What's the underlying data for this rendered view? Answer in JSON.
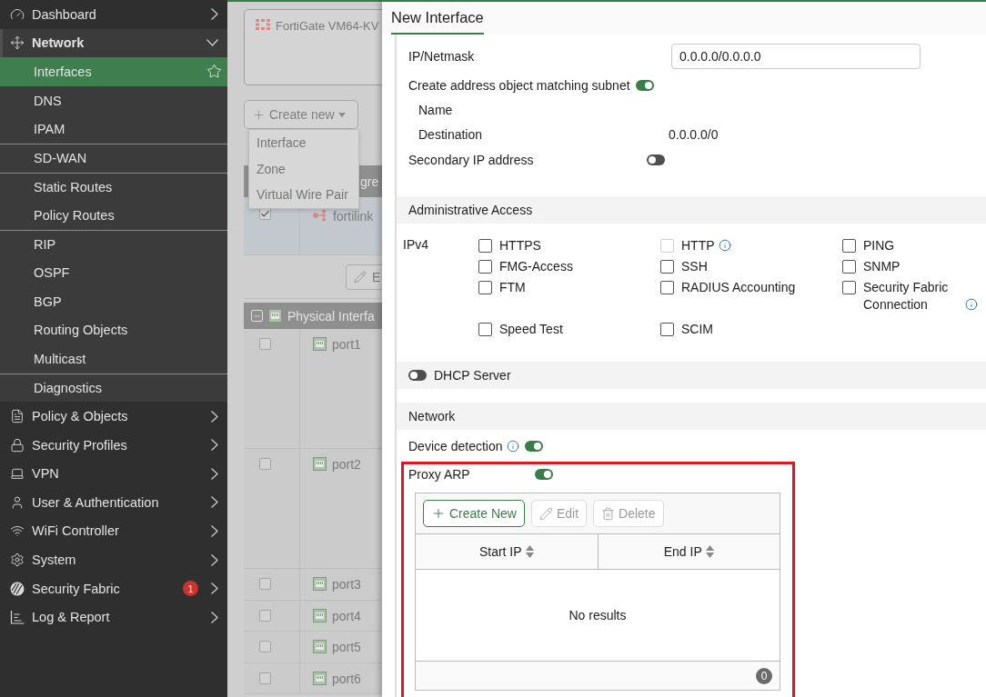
{
  "sidebar": {
    "items": [
      {
        "label": "Dashboard",
        "expanded": false
      },
      {
        "label": "Network",
        "expanded": true,
        "children": [
          {
            "label": "Interfaces",
            "selected": true,
            "divider_before": false
          },
          {
            "label": "DNS",
            "selected": false,
            "divider_before": false
          },
          {
            "label": "IPAM",
            "selected": false,
            "divider_before": false
          },
          {
            "label": "SD-WAN",
            "selected": false,
            "divider_before": true
          },
          {
            "label": "Static Routes",
            "selected": false,
            "divider_before": true
          },
          {
            "label": "Policy Routes",
            "selected": false,
            "divider_before": false
          },
          {
            "label": "RIP",
            "selected": false,
            "divider_before": true
          },
          {
            "label": "OSPF",
            "selected": false,
            "divider_before": false
          },
          {
            "label": "BGP",
            "selected": false,
            "divider_before": false
          },
          {
            "label": "Routing Objects",
            "selected": false,
            "divider_before": false
          },
          {
            "label": "Multicast",
            "selected": false,
            "divider_before": false
          },
          {
            "label": "Diagnostics",
            "selected": false,
            "divider_before": true
          }
        ]
      },
      {
        "label": "Policy & Objects",
        "expanded": false
      },
      {
        "label": "Security Profiles",
        "expanded": false
      },
      {
        "label": "VPN",
        "expanded": false
      },
      {
        "label": "User & Authentication",
        "expanded": false
      },
      {
        "label": "WiFi Controller",
        "expanded": false
      },
      {
        "label": "System",
        "expanded": false
      },
      {
        "label": "Security Fabric",
        "expanded": false,
        "badge": "1"
      },
      {
        "label": "Log & Report",
        "expanded": false
      }
    ]
  },
  "background_page": {
    "device_card": {
      "name": "FortiGate VM64-KV"
    },
    "create_button": "Create new",
    "create_menu": [
      "Interface",
      "Zone",
      "Virtual Wire Pair"
    ],
    "aggregate_header": "gre",
    "fortilink_row": {
      "name": "fortilink",
      "checked": true
    },
    "edit_button": "E",
    "physical_header": "Physical Interfa",
    "ports": [
      {
        "name": "port1",
        "checked": false
      },
      {
        "name": "port2",
        "checked": false
      },
      {
        "name": "port3",
        "checked": false
      },
      {
        "name": "port4",
        "checked": false
      },
      {
        "name": "port5",
        "checked": false
      },
      {
        "name": "port6",
        "checked": false
      }
    ]
  },
  "dialog": {
    "title": "New Interface",
    "ip_netmask": {
      "label": "IP/Netmask",
      "value": "0.0.0.0/0.0.0.0"
    },
    "create_address_object": {
      "label": "Create address object matching subnet",
      "on": true
    },
    "name": {
      "label": "Name"
    },
    "destination": {
      "label": "Destination",
      "value": "0.0.0.0/0"
    },
    "secondary_ip": {
      "label": "Secondary IP address",
      "on": false
    },
    "admin_access": {
      "title": "Administrative Access",
      "protocol_label": "IPv4",
      "options": [
        {
          "label": "HTTPS",
          "checked": false,
          "disabled": false,
          "info": false
        },
        {
          "label": "HTTP",
          "checked": false,
          "disabled": true,
          "info": true
        },
        {
          "label": "PING",
          "checked": false,
          "disabled": false,
          "info": false
        },
        {
          "label": "FMG-Access",
          "checked": false,
          "disabled": false,
          "info": false
        },
        {
          "label": "SSH",
          "checked": false,
          "disabled": false,
          "info": false
        },
        {
          "label": "SNMP",
          "checked": false,
          "disabled": false,
          "info": false
        },
        {
          "label": "FTM",
          "checked": false,
          "disabled": false,
          "info": false
        },
        {
          "label": "RADIUS Accounting",
          "checked": false,
          "disabled": false,
          "info": false
        },
        {
          "label": "Security Fabric Connection",
          "checked": false,
          "disabled": false,
          "info": true
        },
        {
          "label": "Speed Test",
          "checked": false,
          "disabled": false,
          "info": false
        },
        {
          "label": "SCIM",
          "checked": false,
          "disabled": false,
          "info": false
        }
      ]
    },
    "dhcp_server": {
      "label": "DHCP Server",
      "on": false
    },
    "network": {
      "title": "Network",
      "device_detection": {
        "label": "Device detection",
        "on": true,
        "info": true
      },
      "proxy_arp": {
        "label": "Proxy ARP",
        "on": true,
        "highlighted": true,
        "toolbar": [
          {
            "label": "Create New",
            "kind": "create",
            "disabled": false
          },
          {
            "label": "Edit",
            "kind": "edit",
            "disabled": true
          },
          {
            "label": "Delete",
            "kind": "delete",
            "disabled": true
          }
        ],
        "columns": [
          "Start IP",
          "End IP"
        ],
        "empty_text": "No results",
        "count": "0"
      }
    }
  }
}
